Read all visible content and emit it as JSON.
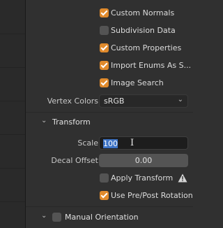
{
  "checkboxes": [
    {
      "label": "Custom Normals",
      "checked": true
    },
    {
      "label": "Subdivision Data",
      "checked": false
    },
    {
      "label": "Custom Properties",
      "checked": true
    },
    {
      "label": "Import Enums As S...",
      "checked": true
    },
    {
      "label": "Image Search",
      "checked": true
    }
  ],
  "vertex_colors": {
    "label": "Vertex Colors",
    "value": "sRGB"
  },
  "transform": {
    "title": "Transform",
    "scale": {
      "label": "Scale",
      "value": "100"
    },
    "decal_offset": {
      "label": "Decal Offset",
      "value": "0.00"
    },
    "apply_transform": {
      "label": "Apply Transform",
      "checked": false
    },
    "use_pre_post_rotation": {
      "label": "Use Pre/Post Rotation",
      "checked": true
    }
  },
  "manual_orientation": {
    "title": "Manual Orientation",
    "checked": false
  },
  "colors": {
    "accent": "#e08a2c",
    "selection": "#3d73c5",
    "background": "#303030"
  }
}
